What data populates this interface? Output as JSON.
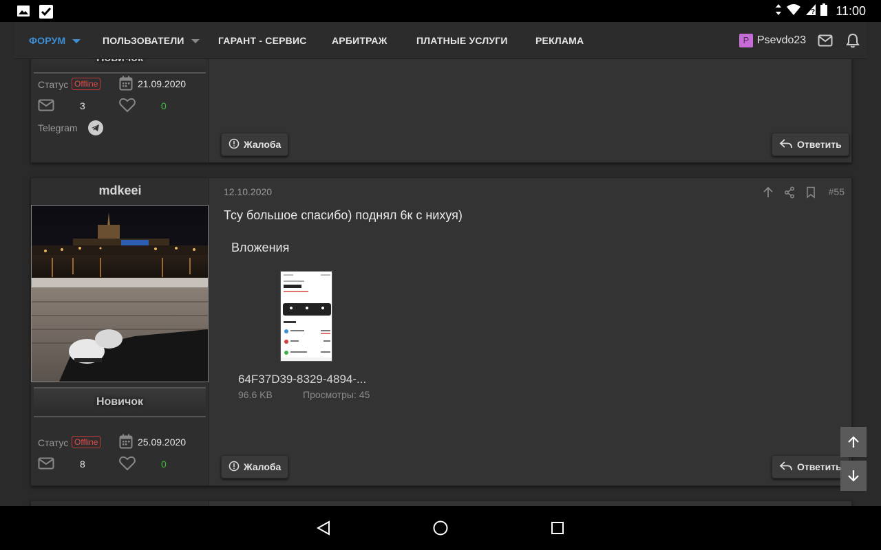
{
  "status_bar": {
    "time": "11:00"
  },
  "nav": {
    "items": [
      {
        "label": "ФОРУМ"
      },
      {
        "label": "ПОЛЬЗОВАТЕЛИ"
      },
      {
        "label": "ГАРАНТ - СЕРВИС"
      },
      {
        "label": "АРБИТРАЖ"
      },
      {
        "label": "ПЛАТНЫЕ УСЛУГИ"
      },
      {
        "label": "РЕКЛАМА"
      }
    ],
    "user_initial": "P",
    "username": "Psevdo23"
  },
  "post_prev": {
    "rank": "Новичок",
    "status_label": "Статус",
    "status": "Offline",
    "joined": "21.09.2020",
    "messages": "3",
    "likes": "0",
    "telegram_label": "Telegram",
    "report_label": "Жалоба",
    "reply_label": "Ответить"
  },
  "post": {
    "username": "mdkeei",
    "rank": "Новичок",
    "status_label": "Статус",
    "status": "Offline",
    "joined": "25.09.2020",
    "messages": "8",
    "likes": "0",
    "date": "12.10.2020",
    "number": "#55",
    "text": "Тсу большое спасибо) поднял 6к с нихуя)",
    "attachments_title": "Вложения",
    "attachment": {
      "name": "64F37D39-8329-4894-...",
      "size": "96.6 KB",
      "views": "Просмотры: 45"
    },
    "report_label": "Жалоба",
    "reply_label": "Ответить"
  },
  "colors": {
    "accent": "#3d8fd6",
    "offline": "#e04a4a",
    "likes": "#3cbf3c"
  }
}
